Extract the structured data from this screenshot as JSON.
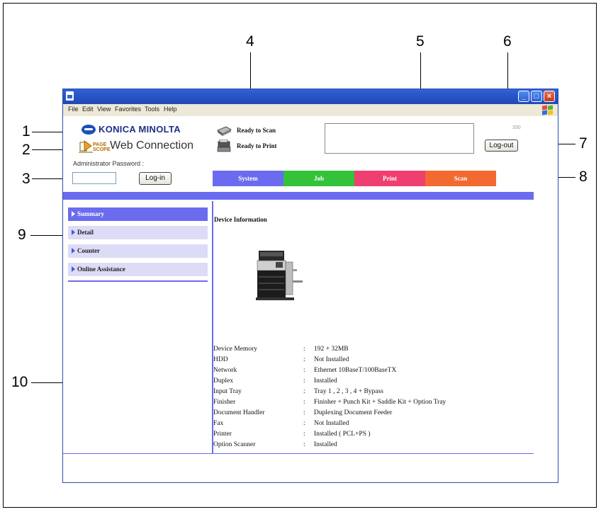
{
  "callouts": [
    "1",
    "2",
    "3",
    "4",
    "5",
    "6",
    "7",
    "8",
    "9",
    "10"
  ],
  "window": {
    "menu": [
      "File",
      "Edit",
      "View",
      "Favorites",
      "Tools",
      "Help"
    ]
  },
  "header": {
    "brand": "KONICA MINOLTA",
    "product_small_1": "PAGE",
    "product_small_2": "SCOPE",
    "product": "Web Connection",
    "admin_label": "Administrator Password :",
    "login_label": "Log-in",
    "logout_label": "Log-out",
    "scan_status": "Ready to Scan",
    "print_status": "Ready to Print",
    "count": "330"
  },
  "tabs": [
    {
      "label": "System",
      "color": "#6b6bef"
    },
    {
      "label": "Job",
      "color": "#33c23a"
    },
    {
      "label": "Print",
      "color": "#ef3f70"
    },
    {
      "label": "Scan",
      "color": "#f26a30"
    }
  ],
  "nav": [
    {
      "label": "Summary",
      "active": true
    },
    {
      "label": "Detail",
      "active": false
    },
    {
      "label": "Counter",
      "active": false
    },
    {
      "label": "Online Assistance",
      "active": false
    }
  ],
  "main": {
    "title": "Device Information",
    "specs": [
      {
        "key": "Device Memory",
        "value": "192 + 32MB"
      },
      {
        "key": "HDD",
        "value": "Not Installed"
      },
      {
        "key": "Network",
        "value": "Ethernet 10BaseT/100BaseTX"
      },
      {
        "key": "Duplex",
        "value": "Installed"
      },
      {
        "key": "Input Tray",
        "value": "Tray 1 , 2 , 3 , 4 + Bypass"
      },
      {
        "key": "Finisher",
        "value": "Finisher + Punch Kit + Saddle Kit + Option Tray"
      },
      {
        "key": "Document Handler",
        "value": "Duplexing Document Feeder"
      },
      {
        "key": "Fax",
        "value": "Not Installed"
      },
      {
        "key": "Printer",
        "value": "Installed ( PCL+PS )"
      },
      {
        "key": "Option Scanner",
        "value": "Installed"
      }
    ]
  }
}
